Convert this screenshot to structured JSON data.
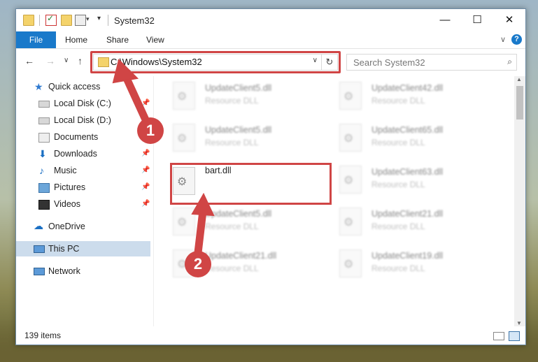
{
  "window": {
    "title": "System32",
    "controls": {
      "minimize": "—",
      "maximize": "☐",
      "close": "✕"
    }
  },
  "ribbon": {
    "tabs": [
      "File",
      "Home",
      "Share",
      "View"
    ],
    "help": "?"
  },
  "address": {
    "path": "C:\\Windows\\System32",
    "search_placeholder": "Search System32"
  },
  "nav": {
    "items": [
      {
        "label": "Quick access",
        "icon": "star-icon",
        "pinned": false
      },
      {
        "label": "Local Disk (C:)",
        "icon": "drive-icon",
        "pinned": true
      },
      {
        "label": "Local Disk (D:)",
        "icon": "drive-icon",
        "pinned": false
      },
      {
        "label": "Documents",
        "icon": "documents-icon",
        "pinned": false
      },
      {
        "label": "Downloads",
        "icon": "download-icon",
        "pinned": true
      },
      {
        "label": "Music",
        "icon": "music-icon",
        "pinned": true
      },
      {
        "label": "Pictures",
        "icon": "pictures-icon",
        "pinned": true
      },
      {
        "label": "Videos",
        "icon": "videos-icon",
        "pinned": true
      },
      {
        "label": "OneDrive",
        "icon": "cloud-icon",
        "pinned": false
      },
      {
        "label": "This PC",
        "icon": "computer-icon",
        "pinned": false,
        "selected": true
      },
      {
        "label": "Network",
        "icon": "network-icon",
        "pinned": false
      }
    ]
  },
  "files": {
    "left": [
      {
        "name": "UpdateClient5.dll",
        "type": "Resource DLL"
      },
      {
        "name": "UpdateClient5.dll",
        "type": "Resource DLL"
      },
      {
        "name": "bart.dll",
        "type": ""
      },
      {
        "name": "UpdateClient5.dll",
        "type": "Resource DLL"
      },
      {
        "name": "UpdateClient21.dll",
        "type": "Resource DLL"
      }
    ],
    "right": [
      {
        "name": "UpdateClient42.dll",
        "type": "Resource DLL"
      },
      {
        "name": "UpdateClient65.dll",
        "type": "Resource DLL"
      },
      {
        "name": "UpdateClient63.dll",
        "type": "Resource DLL"
      },
      {
        "name": "UpdateClient21.dll",
        "type": "Resource DLL"
      },
      {
        "name": "UpdateClient19.dll",
        "type": "Resource DLL"
      }
    ]
  },
  "status": {
    "item_count": "139 items"
  },
  "annotations": {
    "step1": "1",
    "step2": "2",
    "color": "#d04545"
  }
}
